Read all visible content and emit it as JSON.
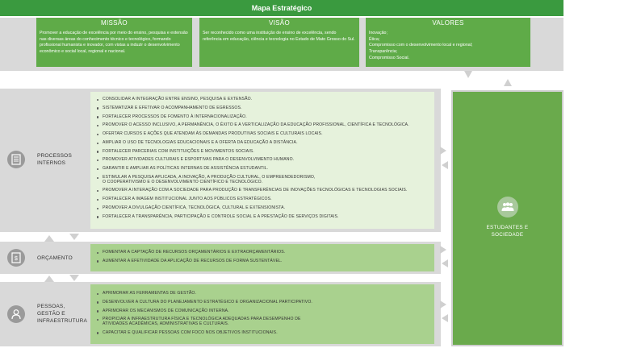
{
  "header": {
    "title": "Mapa Estratégico"
  },
  "missao": {
    "title": "MISSÃO",
    "text": "Promover a educação de excelência por meio do ensino, pesquisa e extensão nas diversas áreas do conhecimento técnico e tecnológico, formando profissional humanista e inovador, com vistas a induzir o desenvolvimento econômico e social local, regional e nacional."
  },
  "visao": {
    "title": "VISÃO",
    "text": "Ser reconhecido como uma instituição de ensino de excelência, sendo referência em educação, ciência e tecnologia no Estado de Mato Grosso do Sul."
  },
  "valores": {
    "title": "VALORES",
    "lines": [
      "Inovação;",
      "Ética;",
      "Compromisso com o desenvolvimento local e regional;",
      "Transparência;",
      "Compromisso Social."
    ]
  },
  "processos": {
    "label_lines": [
      "PROCESSOS",
      "INTERNOS"
    ],
    "icon": "document-icon",
    "items": [
      "CONSOLIDAR A INTEGRAÇÃO ENTRE ENSINO, PESQUISA E EXTENSÃO.",
      "SISTEMATIZAR E EFETIVAR O ACOMPANHAMENTO DE EGRESSOS.",
      "FORTALECER PROCESSOS DE FOMENTO À INTERNACIONALIZAÇÃO.",
      "PROMOVER O ACESSO INCLUSIVO, A PERMANÊNCIA, O ÊXITO E A VERTICALIZAÇÃO DA EDUCAÇÃO PROFISSIONAL, CIENTÍFICA E TECNOLÓGICA.",
      "OFERTAR CURSOS E AÇÕES QUE ATENDAM ÀS DEMANDAS PRODUTIVAS SOCIAIS E CULTURAIS LOCAIS.",
      "AMPLIAR O USO DE TECNOLOGIAS EDUCACIONAIS E A OFERTA DA EDUCAÇÃO A DISTÂNCIA.",
      "FORTALECER PARCERIAS COM INSTITUIÇÕES E MOVIMENTOS SOCIAIS.",
      "PROMOVER ATIVIDADES CULTURAIS E ESPORTIVAS PARA O DESENVOLVIMENTO HUMANO.",
      "GARANTIR E AMPLIAR AS POLÍTICAS INTERNAS DE ASSISTÊNCIA ESTUDANTIL.",
      "ESTIMULAR A PESQUISA APLICADA, A INOVAÇÃO, A PRODUÇÃO CULTURAL, O EMPREENDEDORISMO,\nO COOPERATIVISMO E O DESENVOLVIMENTO CIENTÍFICO E TECNOLÓGICO.",
      "PROMOVER A INTERAÇÃO COM A SOCIEDADE PARA PRODUÇÃO E TRANSFERÊNCIAS DE INOVAÇÕES TECNOLÓGICAS E TECNOLOGIAS SOCIAIS.",
      "FORTALECER A IMAGEM INSTITUCIONAL JUNTO AOS PÚBLICOS ESTRATÉGICOS.",
      "PROMOVER A DIVULGAÇÃO CIENTÍFICA, TECNOLÓGICA, CULTURAL E EXTENSIONISTA.",
      "FORTALECER A TRANSPARÊNCIA, PARTICIPAÇÃO E CONTROLE SOCIAL E A PRESTAÇÃO DE SERVIÇOS DIGITAIS."
    ]
  },
  "orcamento": {
    "label": "ORÇAMENTO",
    "icon": "budget-icon",
    "items": [
      "FOMENTAR A CAPTAÇÃO DE RECURSOS ORÇAMENTÁRIOS E EXTRAORÇAMENTÁRIOS.",
      "AUMENTAR A EFETIVIDADE DA APLICAÇÃO DE RECURSOS DE FORMA SUSTENTÁVEL."
    ]
  },
  "pessoas": {
    "label_lines": [
      "PESSOAS,",
      "GESTÃO E",
      "INFRAESTRUTURA"
    ],
    "icon": "person-icon",
    "items": [
      "APRIMORAR AS FERRAMENTAS DE GESTÃO.",
      "DESENVOLVER A CULTURA DO PLANEJAMENTO ESTRATÉGICO E ORGANIZACIONAL PARTICIPATIVO.",
      "APRIMORAR OS MECANISMOS DE COMUNICAÇÃO INTERNA.",
      "PROPICIAR A INFRAESTRUTURA FÍSICA E TECNOLÓGICA ADEQUADAS PARA DESEMPENHO DE\nATIVIDADES ACADÊMICAS, ADMINISTRATIVAS E CULTURAIS.",
      "CAPACITAR E QUALIFICAR PESSOAS COM FOCO NOS OBJETIVOS INSTITUCIONAIS."
    ]
  },
  "estudantes": {
    "label_lines": [
      "ESTUDANTES E",
      "SOCIEDADE"
    ],
    "icon": "group-icon"
  },
  "colors": {
    "header_green": "#3a9a3f",
    "box_green": "#5fab48",
    "light_green": "#e6f2dc",
    "mid_green": "#a9d18e",
    "grey": "#d9d9d9"
  }
}
